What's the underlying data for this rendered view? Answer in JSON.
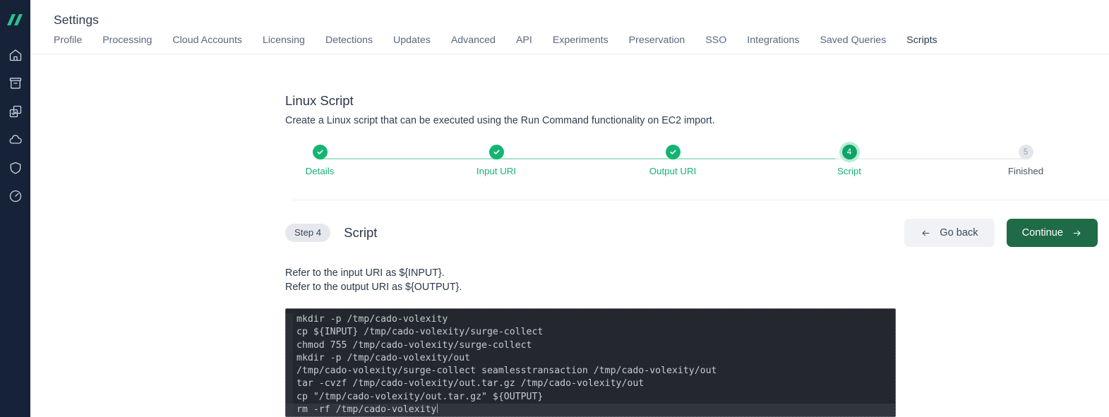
{
  "sidebar": {
    "logo": "double-slash-logo",
    "items": [
      {
        "icon": "home-icon",
        "name": "home"
      },
      {
        "icon": "archive-box-icon",
        "name": "cases"
      },
      {
        "icon": "tasks-checklist-icon",
        "name": "tasks"
      },
      {
        "icon": "cloud-icon",
        "name": "cloud"
      },
      {
        "icon": "shield-icon",
        "name": "security"
      },
      {
        "icon": "gauge-icon",
        "name": "performance"
      }
    ]
  },
  "header": {
    "title": "Settings",
    "tabs": [
      {
        "label": "Profile",
        "active": false
      },
      {
        "label": "Processing",
        "active": false
      },
      {
        "label": "Cloud Accounts",
        "active": false
      },
      {
        "label": "Licensing",
        "active": false
      },
      {
        "label": "Detections",
        "active": false
      },
      {
        "label": "Updates",
        "active": false
      },
      {
        "label": "Advanced",
        "active": false
      },
      {
        "label": "API",
        "active": false
      },
      {
        "label": "Experiments",
        "active": false
      },
      {
        "label": "Preservation",
        "active": false
      },
      {
        "label": "SSO",
        "active": false
      },
      {
        "label": "Integrations",
        "active": false
      },
      {
        "label": "Saved Queries",
        "active": false
      },
      {
        "label": "Scripts",
        "active": true
      }
    ]
  },
  "wizard": {
    "title": "Linux Script",
    "description": "Create a Linux script that can be executed using the Run Command functionality on EC2 import.",
    "steps": [
      {
        "label": "Details",
        "number": "1",
        "state": "done"
      },
      {
        "label": "Input URI",
        "number": "2",
        "state": "done"
      },
      {
        "label": "Output URI",
        "number": "3",
        "state": "done"
      },
      {
        "label": "Script",
        "number": "4",
        "state": "current"
      },
      {
        "label": "Finished",
        "number": "5",
        "state": "todo"
      }
    ],
    "step_badge": "Step 4",
    "step_name": "Script",
    "back_label": "Go back",
    "continue_label": "Continue",
    "instruction_line1": "Refer to the input URI as ${INPUT}.",
    "instruction_line2": "Refer to the output URI as ${OUTPUT}.",
    "code_lines": [
      "mkdir -p /tmp/cado-volexity",
      "cp ${INPUT} /tmp/cado-volexity/surge-collect",
      "chmod 755 /tmp/cado-volexity/surge-collect",
      "mkdir -p /tmp/cado-volexity/out",
      "/tmp/cado-volexity/surge-collect seamlesstransaction /tmp/cado-volexity/out",
      "tar -cvzf /tmp/cado-volexity/out.tar.gz /tmp/cado-volexity/out",
      "cp \"/tmp/cado-volexity/out.tar.gz\" ${OUTPUT}",
      "rm -rf /tmp/cado-volexity"
    ],
    "active_code_line_index": 7
  },
  "colors": {
    "sidebar_bg": "#152238",
    "brand_green": "#2fbf8f",
    "step_done": "#15b474",
    "step_current": "#0fa367",
    "continue_bg": "#1f6b47",
    "editor_bg": "#24272e",
    "caret": "#3ddc84"
  }
}
